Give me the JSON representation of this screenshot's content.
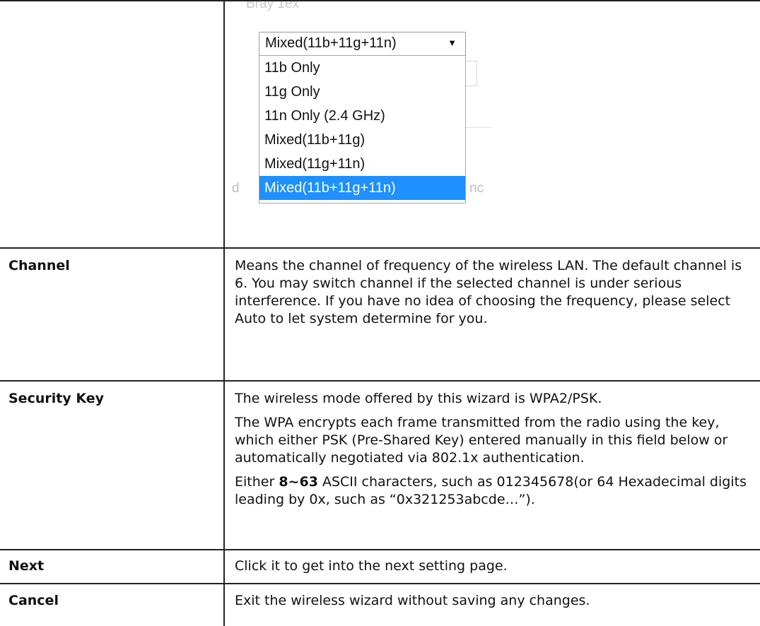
{
  "dropdown": {
    "ghost_top": "Bray 1ex",
    "ghost_left": "d",
    "ghost_right": "nc",
    "selected_value": "Mixed(11b+11g+11n)",
    "arrow": "▼",
    "options": [
      "11b Only",
      "11g Only",
      "11n Only (2.4 GHz)",
      "Mixed(11b+11g)",
      "Mixed(11g+11n)",
      "Mixed(11b+11g+11n)"
    ],
    "highlight_color": "#1e90ff"
  },
  "rows": {
    "channel": {
      "label": "Channel",
      "text": "Means the channel of frequency of the wireless LAN. The default channel is 6. You may switch channel if the selected channel is under serious interference. If you have no idea of choosing the frequency, please select Auto to let system determine for you."
    },
    "security_key": {
      "label": "Security Key",
      "p1": "The wireless mode offered by this wizard is WPA2/PSK.",
      "p2": "The WPA encrypts each frame transmitted from the radio using the key, which either PSK (Pre-Shared Key) entered manually in this field below or automatically negotiated via 802.1x authentication.",
      "p3_prefix": "Either ",
      "p3_bold": "8~63",
      "p3_suffix": " ASCII characters, such as 012345678(or 64 Hexadecimal digits leading by 0x, such as “0x321253abcde…”)."
    },
    "next": {
      "label": "Next",
      "text": "Click it to get into the next setting page."
    },
    "cancel": {
      "label": "Cancel",
      "text": "Exit the wireless wizard without saving any changes."
    }
  }
}
